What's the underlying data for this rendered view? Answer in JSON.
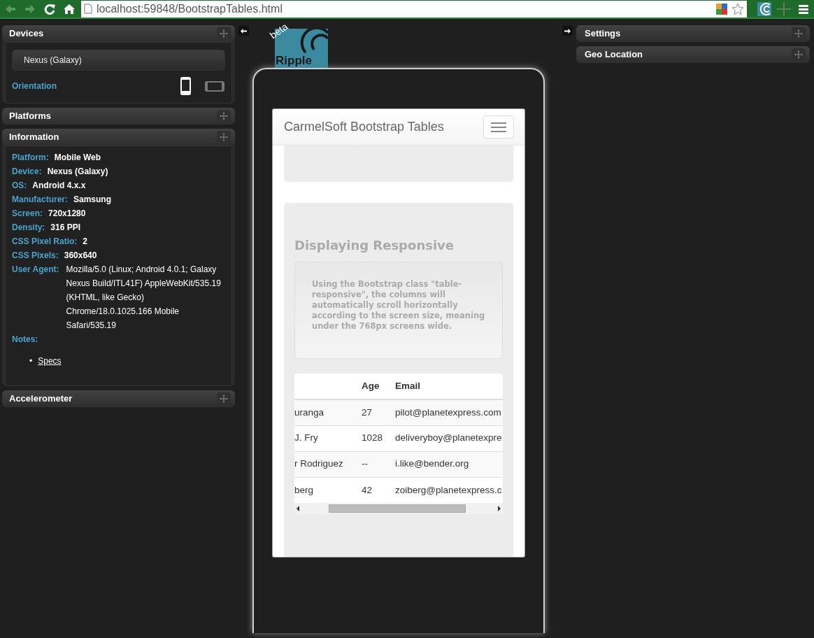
{
  "browser": {
    "url": "localhost:59848/BootstrapTables.html"
  },
  "left_panels": [
    {
      "kind": "devices",
      "title": "Devices",
      "expanded": true,
      "device": "Nexus (Galaxy)",
      "orientation_label": "Orientation",
      "orientations": [
        {
          "kind": "portrait",
          "selected": true
        },
        {
          "kind": "landscape",
          "selected": false
        }
      ]
    },
    {
      "kind": "plain",
      "title": "Platforms",
      "expanded": false
    },
    {
      "kind": "info",
      "title": "Information",
      "expanded": true,
      "fields": [
        {
          "label": "Platform:",
          "value": "Mobile Web",
          "kind": "bold"
        },
        {
          "label": "Device:",
          "value": "Nexus (Galaxy)",
          "kind": "bold"
        },
        {
          "label": "OS:",
          "value": "Android 4.x.x",
          "kind": "bold"
        },
        {
          "label": "Manufacturer:",
          "value": "Samsung",
          "kind": "bold"
        },
        {
          "label": "Screen:",
          "value": "720x1280",
          "kind": "bold"
        },
        {
          "label": "Density:",
          "value": "316 PPI",
          "kind": "bold"
        },
        {
          "label": "CSS Pixel Ratio:",
          "value": "2",
          "kind": "bold"
        },
        {
          "label": "CSS Pixels:",
          "value": "360x640",
          "kind": "bold"
        },
        {
          "label": "User Agent:",
          "value": "Mozilla/5.0 (Linux; Android 4.0.1; Galaxy Nexus Build/ITL41F) AppleWebKit/535.19 (KHTML, like Gecko) Chrome/18.0.1025.166 Mobile Safari/535.19",
          "kind": "long"
        }
      ],
      "notes_label": "Notes:",
      "notes": [
        {
          "bullet": "•",
          "label": "Specs"
        }
      ]
    },
    {
      "kind": "plain",
      "title": "Accelerometer",
      "expanded": false
    }
  ],
  "logo": {
    "badge": "beta",
    "name": "Ripple"
  },
  "right_panels": [
    {
      "title": "Settings"
    },
    {
      "title": "Geo Location"
    }
  ],
  "device_screen": {
    "brand": "CarmelSoft Bootstrap Tables",
    "heading": "Displaying Responsive",
    "note": "Using the Bootstrap class \"table-responsive\", the columns will automatically scroll horizontally according to the screen size, meaning under the 768px screens wide.",
    "table": {
      "columns": [
        "",
        "Age",
        "Email"
      ],
      "rows": [
        [
          "uranga",
          "27",
          "pilot@planetexpress.com"
        ],
        [
          "J. Fry",
          "1028",
          "deliveryboy@planetexpre"
        ],
        [
          "r Rodriguez",
          "--",
          "i.like@bender.org"
        ],
        [
          "berg",
          "42",
          "zoiberg@planetexpress.c"
        ]
      ]
    }
  }
}
